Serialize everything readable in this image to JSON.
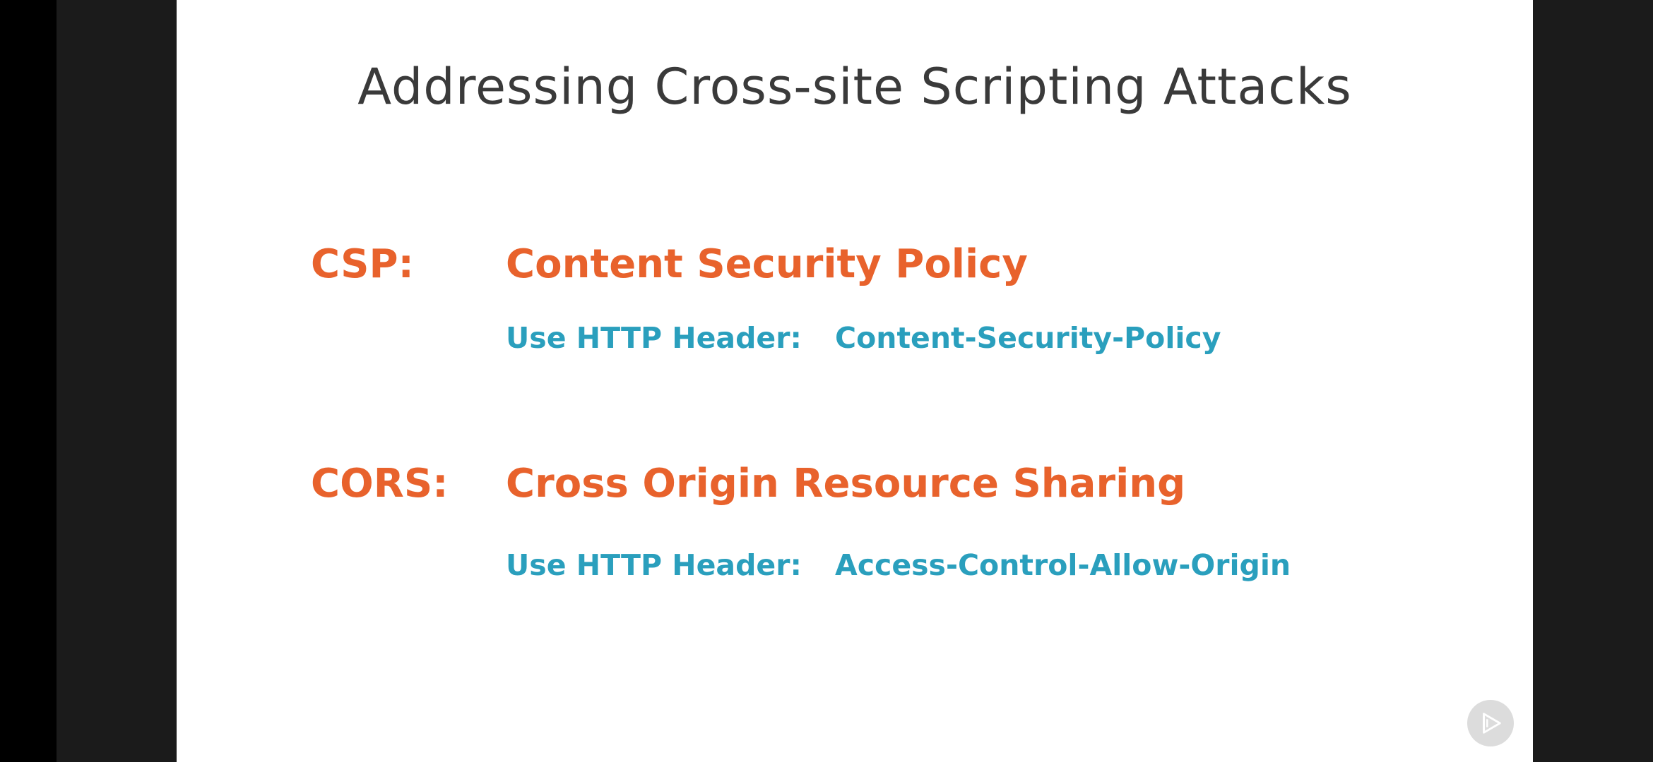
{
  "slide": {
    "title": "Addressing Cross-site Scripting Attacks",
    "items": [
      {
        "abbr": "CSP:",
        "full": "Content Security Policy",
        "detail_label": "Use HTTP Header:",
        "detail_value": "Content-Security-Policy"
      },
      {
        "abbr": "CORS:",
        "full": "Cross Origin Resource Sharing",
        "detail_label": "Use HTTP Header:",
        "detail_value": "Access-Control-Allow-Origin"
      }
    ]
  },
  "player": {
    "badge_icon": "pluralsight-play-icon"
  },
  "colors": {
    "term": "#e8622c",
    "detail": "#2a9fbd",
    "title": "#3a3a3a",
    "background": "#ffffff",
    "letterbox": "#1b1b1b"
  }
}
